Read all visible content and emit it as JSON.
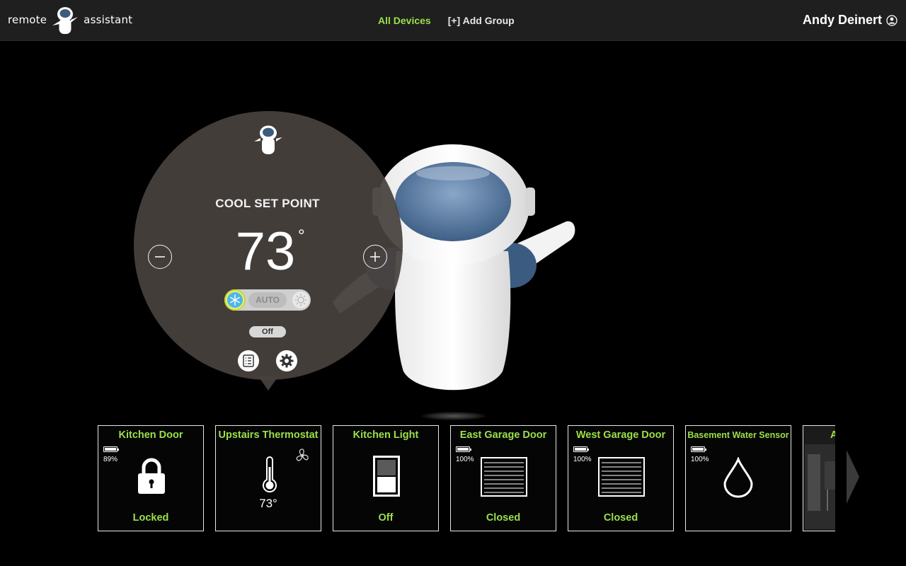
{
  "header": {
    "brand_left": "remote",
    "brand_right": "assistant",
    "nav": {
      "all_devices": "All Devices",
      "add_group": "[+] Add Group"
    },
    "user_name": "Andy Deinert",
    "accent_color": "#9be04a"
  },
  "thermostat_popup": {
    "setpoint_label": "COOL SET POINT",
    "temperature": "73",
    "degree_symbol": "°",
    "mode_auto_label": "AUTO",
    "active_mode": "cool",
    "fan_label": "Off",
    "icons": [
      "minus-icon",
      "plus-icon",
      "snowflake-icon",
      "sun-icon",
      "schedule-list-icon",
      "gear-icon"
    ]
  },
  "devices": [
    {
      "name": "Kitchen Door",
      "battery": "89%",
      "status": "Locked",
      "icon": "lock-icon"
    },
    {
      "name": "Upstairs Thermostat",
      "temperature": "73°",
      "icon": "thermometer-icon",
      "secondary_icon": "fan-icon"
    },
    {
      "name": "Kitchen Light",
      "status": "Off",
      "icon": "light-switch-icon"
    },
    {
      "name": "East Garage Door",
      "battery": "100%",
      "status": "Closed",
      "icon": "garage-door-icon"
    },
    {
      "name": "West Garage Door",
      "battery": "100%",
      "status": "Closed",
      "icon": "garage-door-icon"
    },
    {
      "name": "Basement Water Sensor",
      "battery": "100%",
      "icon": "water-drop-icon"
    },
    {
      "name": "A",
      "icon": "camera-thumbnail"
    }
  ]
}
